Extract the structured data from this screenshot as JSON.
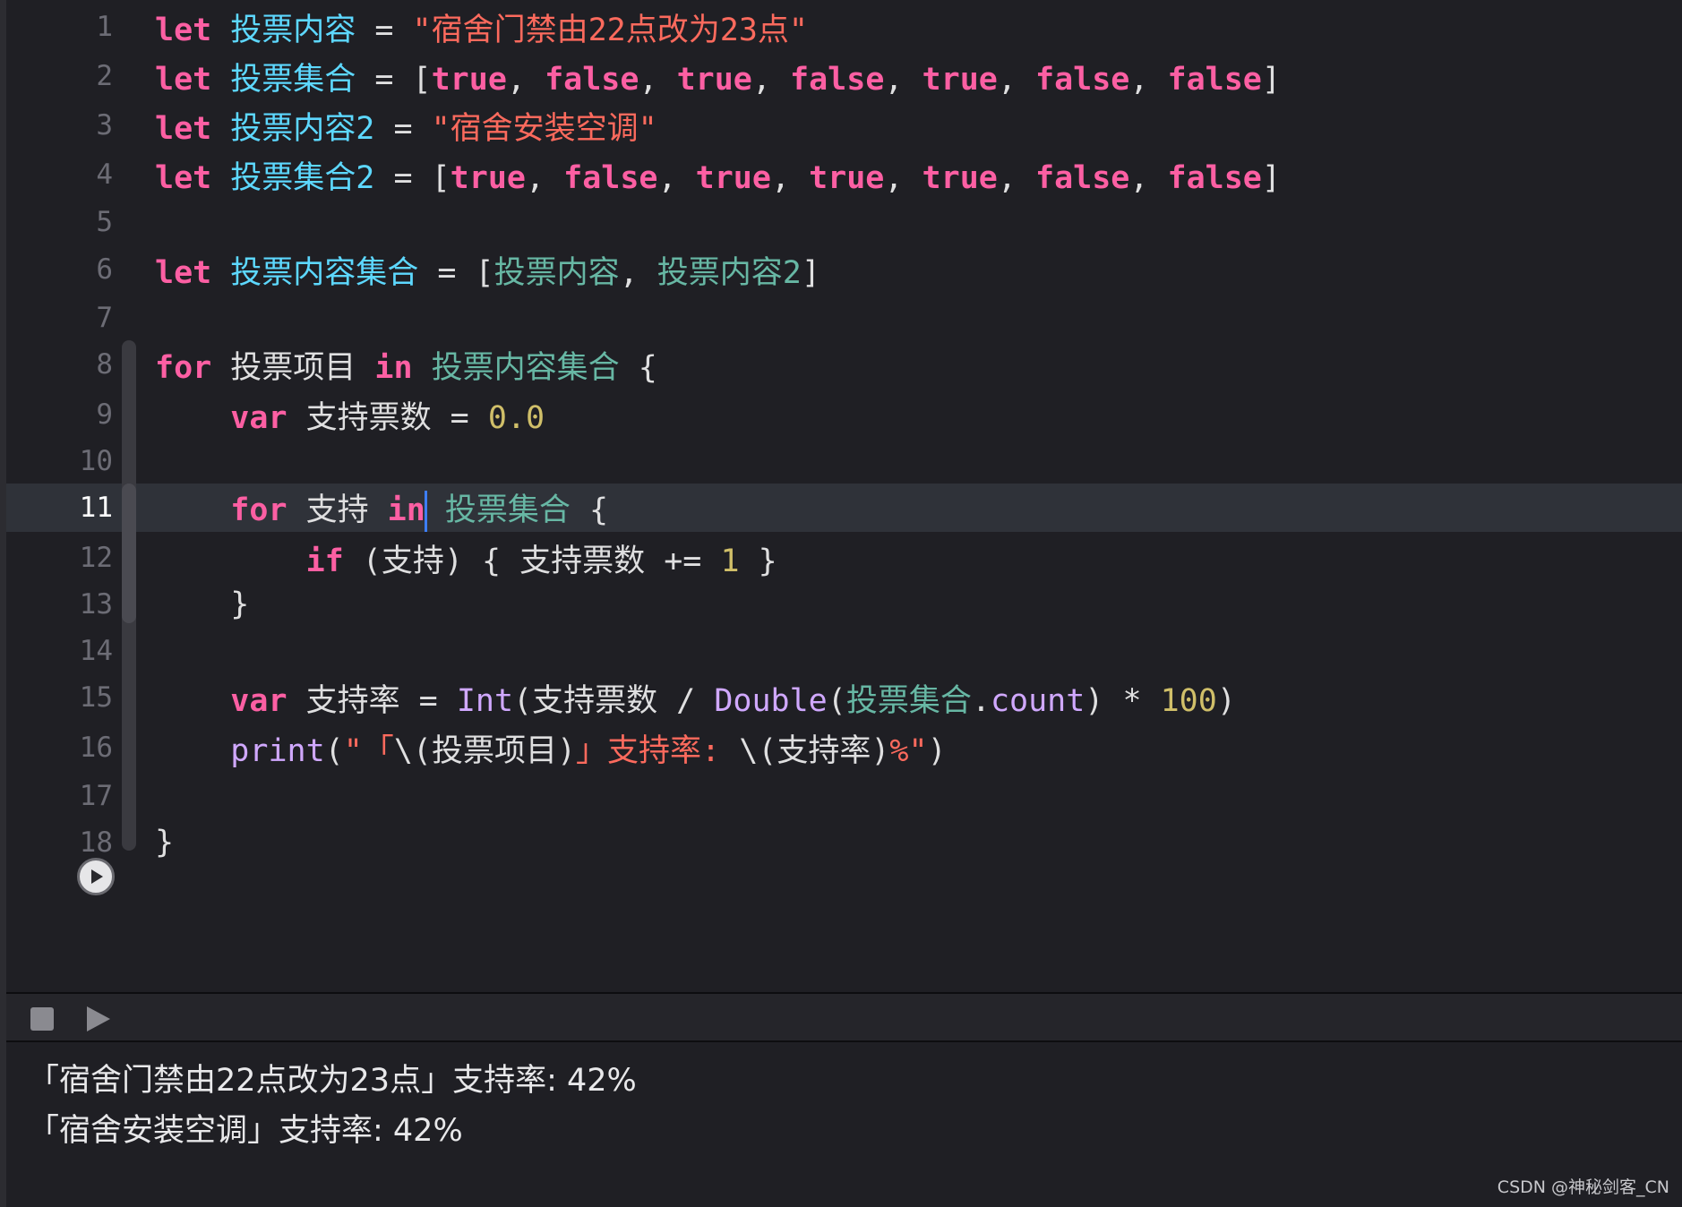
{
  "editor": {
    "current_line": "11",
    "lines": [
      {
        "number": "1",
        "tokens": [
          [
            "kw",
            "let"
          ],
          [
            "pl",
            " "
          ],
          [
            "decl",
            "投票内容"
          ],
          [
            "pl",
            " = "
          ],
          [
            "str",
            "\"宿舍门禁由22点改为23点\""
          ]
        ]
      },
      {
        "number": "2",
        "tokens": [
          [
            "kw",
            "let"
          ],
          [
            "pl",
            " "
          ],
          [
            "decl",
            "投票集合"
          ],
          [
            "pl",
            " = ["
          ],
          [
            "kw",
            "true"
          ],
          [
            "pl",
            ", "
          ],
          [
            "kw",
            "false"
          ],
          [
            "pl",
            ", "
          ],
          [
            "kw",
            "true"
          ],
          [
            "pl",
            ", "
          ],
          [
            "kw",
            "false"
          ],
          [
            "pl",
            ", "
          ],
          [
            "kw",
            "true"
          ],
          [
            "pl",
            ", "
          ],
          [
            "kw",
            "false"
          ],
          [
            "pl",
            ", "
          ],
          [
            "kw",
            "false"
          ],
          [
            "pl",
            "]"
          ]
        ]
      },
      {
        "number": "3",
        "tokens": [
          [
            "kw",
            "let"
          ],
          [
            "pl",
            " "
          ],
          [
            "decl",
            "投票内容2"
          ],
          [
            "pl",
            " = "
          ],
          [
            "str",
            "\"宿舍安装空调\""
          ]
        ]
      },
      {
        "number": "4",
        "tokens": [
          [
            "kw",
            "let"
          ],
          [
            "pl",
            " "
          ],
          [
            "decl",
            "投票集合2"
          ],
          [
            "pl",
            " = ["
          ],
          [
            "kw",
            "true"
          ],
          [
            "pl",
            ", "
          ],
          [
            "kw",
            "false"
          ],
          [
            "pl",
            ", "
          ],
          [
            "kw",
            "true"
          ],
          [
            "pl",
            ", "
          ],
          [
            "kw",
            "true"
          ],
          [
            "pl",
            ", "
          ],
          [
            "kw",
            "true"
          ],
          [
            "pl",
            ", "
          ],
          [
            "kw",
            "false"
          ],
          [
            "pl",
            ", "
          ],
          [
            "kw",
            "false"
          ],
          [
            "pl",
            "]"
          ]
        ]
      },
      {
        "number": "5",
        "tokens": []
      },
      {
        "number": "6",
        "tokens": [
          [
            "kw",
            "let"
          ],
          [
            "pl",
            " "
          ],
          [
            "decl",
            "投票内容集合"
          ],
          [
            "pl",
            " = ["
          ],
          [
            "ref",
            "投票内容"
          ],
          [
            "pl",
            ", "
          ],
          [
            "ref",
            "投票内容2"
          ],
          [
            "pl",
            "]"
          ]
        ]
      },
      {
        "number": "7",
        "tokens": []
      },
      {
        "number": "8",
        "tokens": [
          [
            "kw",
            "for"
          ],
          [
            "pl",
            " 投票项目 "
          ],
          [
            "kw",
            "in"
          ],
          [
            "pl",
            " "
          ],
          [
            "ref",
            "投票内容集合"
          ],
          [
            "pl",
            " {"
          ]
        ]
      },
      {
        "number": "9",
        "tokens": [
          [
            "pl",
            "    "
          ],
          [
            "kw",
            "var"
          ],
          [
            "pl",
            " 支持票数 = "
          ],
          [
            "num",
            "0.0"
          ]
        ]
      },
      {
        "number": "10",
        "tokens": []
      },
      {
        "number": "11",
        "tokens": [
          [
            "pl",
            "    "
          ],
          [
            "kw",
            "for"
          ],
          [
            "pl",
            " 支持 "
          ],
          [
            "kw",
            "in"
          ],
          [
            "caret",
            ""
          ],
          [
            "pl",
            " "
          ],
          [
            "ref",
            "投票集合"
          ],
          [
            "pl",
            " {"
          ]
        ]
      },
      {
        "number": "12",
        "tokens": [
          [
            "pl",
            "        "
          ],
          [
            "kw",
            "if"
          ],
          [
            "pl",
            " (支持) { 支持票数 += "
          ],
          [
            "num",
            "1"
          ],
          [
            "pl",
            " }"
          ]
        ]
      },
      {
        "number": "13",
        "tokens": [
          [
            "pl",
            "    }"
          ]
        ]
      },
      {
        "number": "14",
        "tokens": []
      },
      {
        "number": "15",
        "tokens": [
          [
            "pl",
            "    "
          ],
          [
            "kw",
            "var"
          ],
          [
            "pl",
            " 支持率 = "
          ],
          [
            "fn",
            "Int"
          ],
          [
            "pl",
            "(支持票数 / "
          ],
          [
            "fn",
            "Double"
          ],
          [
            "pl",
            "("
          ],
          [
            "ref",
            "投票集合"
          ],
          [
            "pl",
            "."
          ],
          [
            "fn",
            "count"
          ],
          [
            "pl",
            ") * "
          ],
          [
            "num",
            "100"
          ],
          [
            "pl",
            ")"
          ]
        ]
      },
      {
        "number": "16",
        "tokens": [
          [
            "pl",
            "    "
          ],
          [
            "fn",
            "print"
          ],
          [
            "pl",
            "("
          ],
          [
            "str",
            "\"「"
          ],
          [
            "pl",
            "\\(投票项目)"
          ],
          [
            "str",
            "」支持率: "
          ],
          [
            "pl",
            "\\(支持率)"
          ],
          [
            "str",
            "%\""
          ],
          [
            "pl",
            ")"
          ]
        ]
      },
      {
        "number": "17",
        "tokens": []
      },
      {
        "number": "18",
        "tokens": [
          [
            "pl",
            "}"
          ]
        ]
      }
    ],
    "run_icon": "play-circle-icon"
  },
  "debug_bar": {
    "stop_icon": "stop-square-icon",
    "play_icon": "play-triangle-icon"
  },
  "console": {
    "lines": [
      "「宿舍门禁由22点改为23点」支持率: 42%",
      "「宿舍安装空调」支持率: 42%"
    ]
  },
  "watermark": "CSDN @神秘剑客_CN",
  "colors": {
    "keyword": "#fc5fa3",
    "declaration": "#5dd8ff",
    "reference": "#67b7a4",
    "string": "#fc6a5d",
    "number": "#d0bf69",
    "function": "#d0a8ff",
    "plain": "#dfdfe0",
    "background": "#1f1f24",
    "current_line": "#2f3239",
    "caret": "#3d7ef8"
  }
}
